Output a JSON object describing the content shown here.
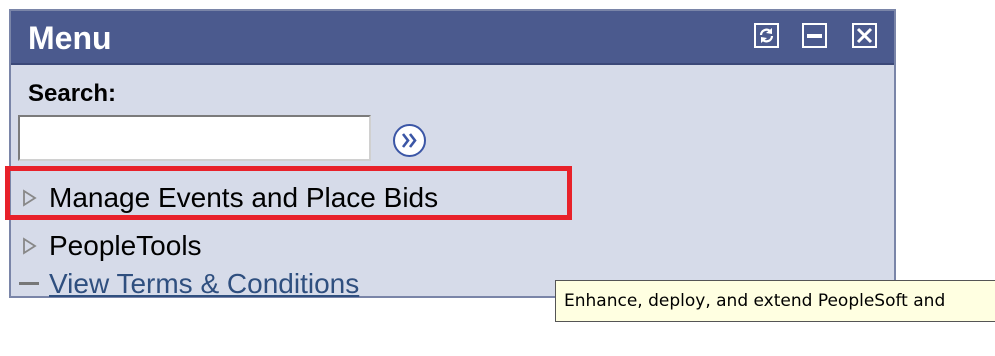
{
  "menu": {
    "title": "Menu",
    "header_buttons": [
      {
        "icon": "refresh-icon"
      },
      {
        "icon": "minimize-icon"
      },
      {
        "icon": "close-icon"
      }
    ]
  },
  "search": {
    "label": "Search:",
    "value": "",
    "placeholder": "",
    "go_icon": "double-chevron-right-icon"
  },
  "nav": {
    "items": [
      {
        "label": "Manage Events and Place Bids",
        "icon": "expand-triangle-icon"
      },
      {
        "label": "PeopleTools",
        "icon": "expand-triangle-icon"
      },
      {
        "label": "View Terms & Conditions",
        "icon": "dash-icon",
        "link": true
      }
    ]
  },
  "tooltip": {
    "text": "Enhance, deploy, and extend PeopleSoft and"
  },
  "colors": {
    "header_bg": "#4b5a8e",
    "panel_bg": "#d6dbe9",
    "highlight": "#e8212a",
    "link": "#2f4f7f",
    "tooltip_bg": "#ffffe1"
  }
}
